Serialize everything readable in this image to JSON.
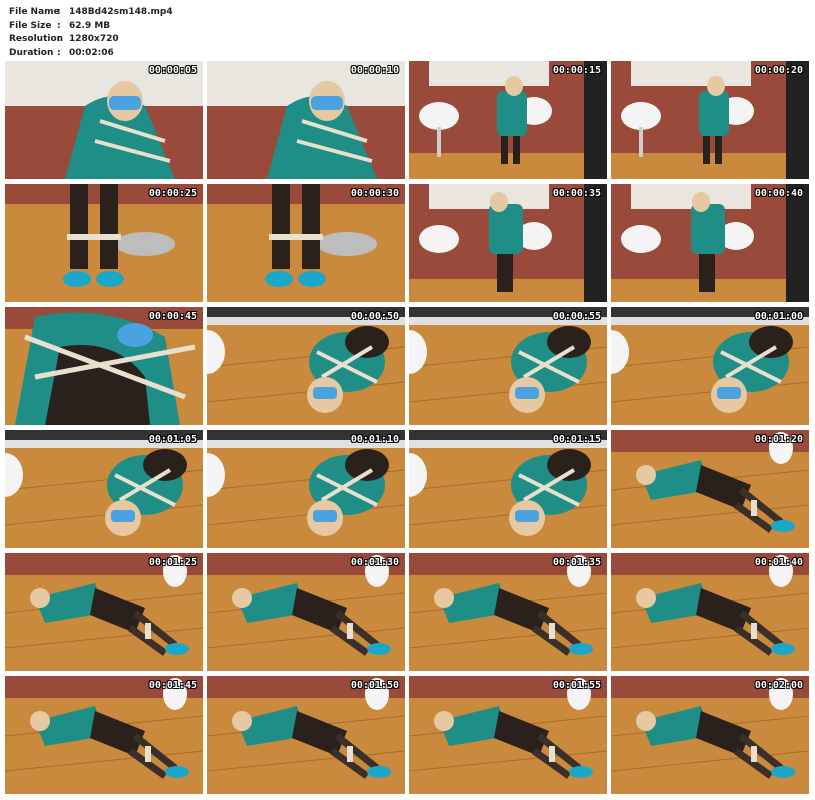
{
  "header": {
    "fields": [
      {
        "label": "File Name",
        "sep": ":",
        "value": "148Bd42sm148.mp4"
      },
      {
        "label": "File Size",
        "sep": ":",
        "value": "62.9 MB"
      },
      {
        "label": "Resolution",
        "sep": ":",
        "value": "1280x720"
      },
      {
        "label": "Duration",
        "sep": ":",
        "value": "00:02:06"
      }
    ]
  },
  "colors": {
    "floor": "#c98a3e",
    "floor_dark": "#a86a28",
    "brick": "#9a4a3a",
    "jacket": "#1f8e86",
    "skirt": "#2a211d",
    "rope": "#e8e0cf",
    "shoe": "#1aa7c8",
    "wall": "#e9e6df"
  },
  "thumbnails": [
    {
      "timestamp": "00:00:05",
      "scene": "seated-closeup"
    },
    {
      "timestamp": "00:00:10",
      "scene": "seated-closeup"
    },
    {
      "timestamp": "00:00:15",
      "scene": "chair-room"
    },
    {
      "timestamp": "00:00:20",
      "scene": "chair-room"
    },
    {
      "timestamp": "00:00:25",
      "scene": "feet-closeup"
    },
    {
      "timestamp": "00:00:30",
      "scene": "feet-closeup"
    },
    {
      "timestamp": "00:00:35",
      "scene": "standing-room"
    },
    {
      "timestamp": "00:00:40",
      "scene": "standing-room"
    },
    {
      "timestamp": "00:00:45",
      "scene": "body-closeup"
    },
    {
      "timestamp": "00:00:50",
      "scene": "floor-face"
    },
    {
      "timestamp": "00:00:55",
      "scene": "floor-face"
    },
    {
      "timestamp": "00:01:00",
      "scene": "floor-face"
    },
    {
      "timestamp": "00:01:05",
      "scene": "floor-face"
    },
    {
      "timestamp": "00:01:10",
      "scene": "floor-face"
    },
    {
      "timestamp": "00:01:15",
      "scene": "floor-face"
    },
    {
      "timestamp": "00:01:20",
      "scene": "floor-full"
    },
    {
      "timestamp": "00:01:25",
      "scene": "floor-full"
    },
    {
      "timestamp": "00:01:30",
      "scene": "floor-full"
    },
    {
      "timestamp": "00:01:35",
      "scene": "floor-full"
    },
    {
      "timestamp": "00:01:40",
      "scene": "floor-full"
    },
    {
      "timestamp": "00:01:45",
      "scene": "floor-full"
    },
    {
      "timestamp": "00:01:50",
      "scene": "floor-full"
    },
    {
      "timestamp": "00:01:55",
      "scene": "floor-full"
    },
    {
      "timestamp": "00:02:00",
      "scene": "floor-full"
    }
  ]
}
